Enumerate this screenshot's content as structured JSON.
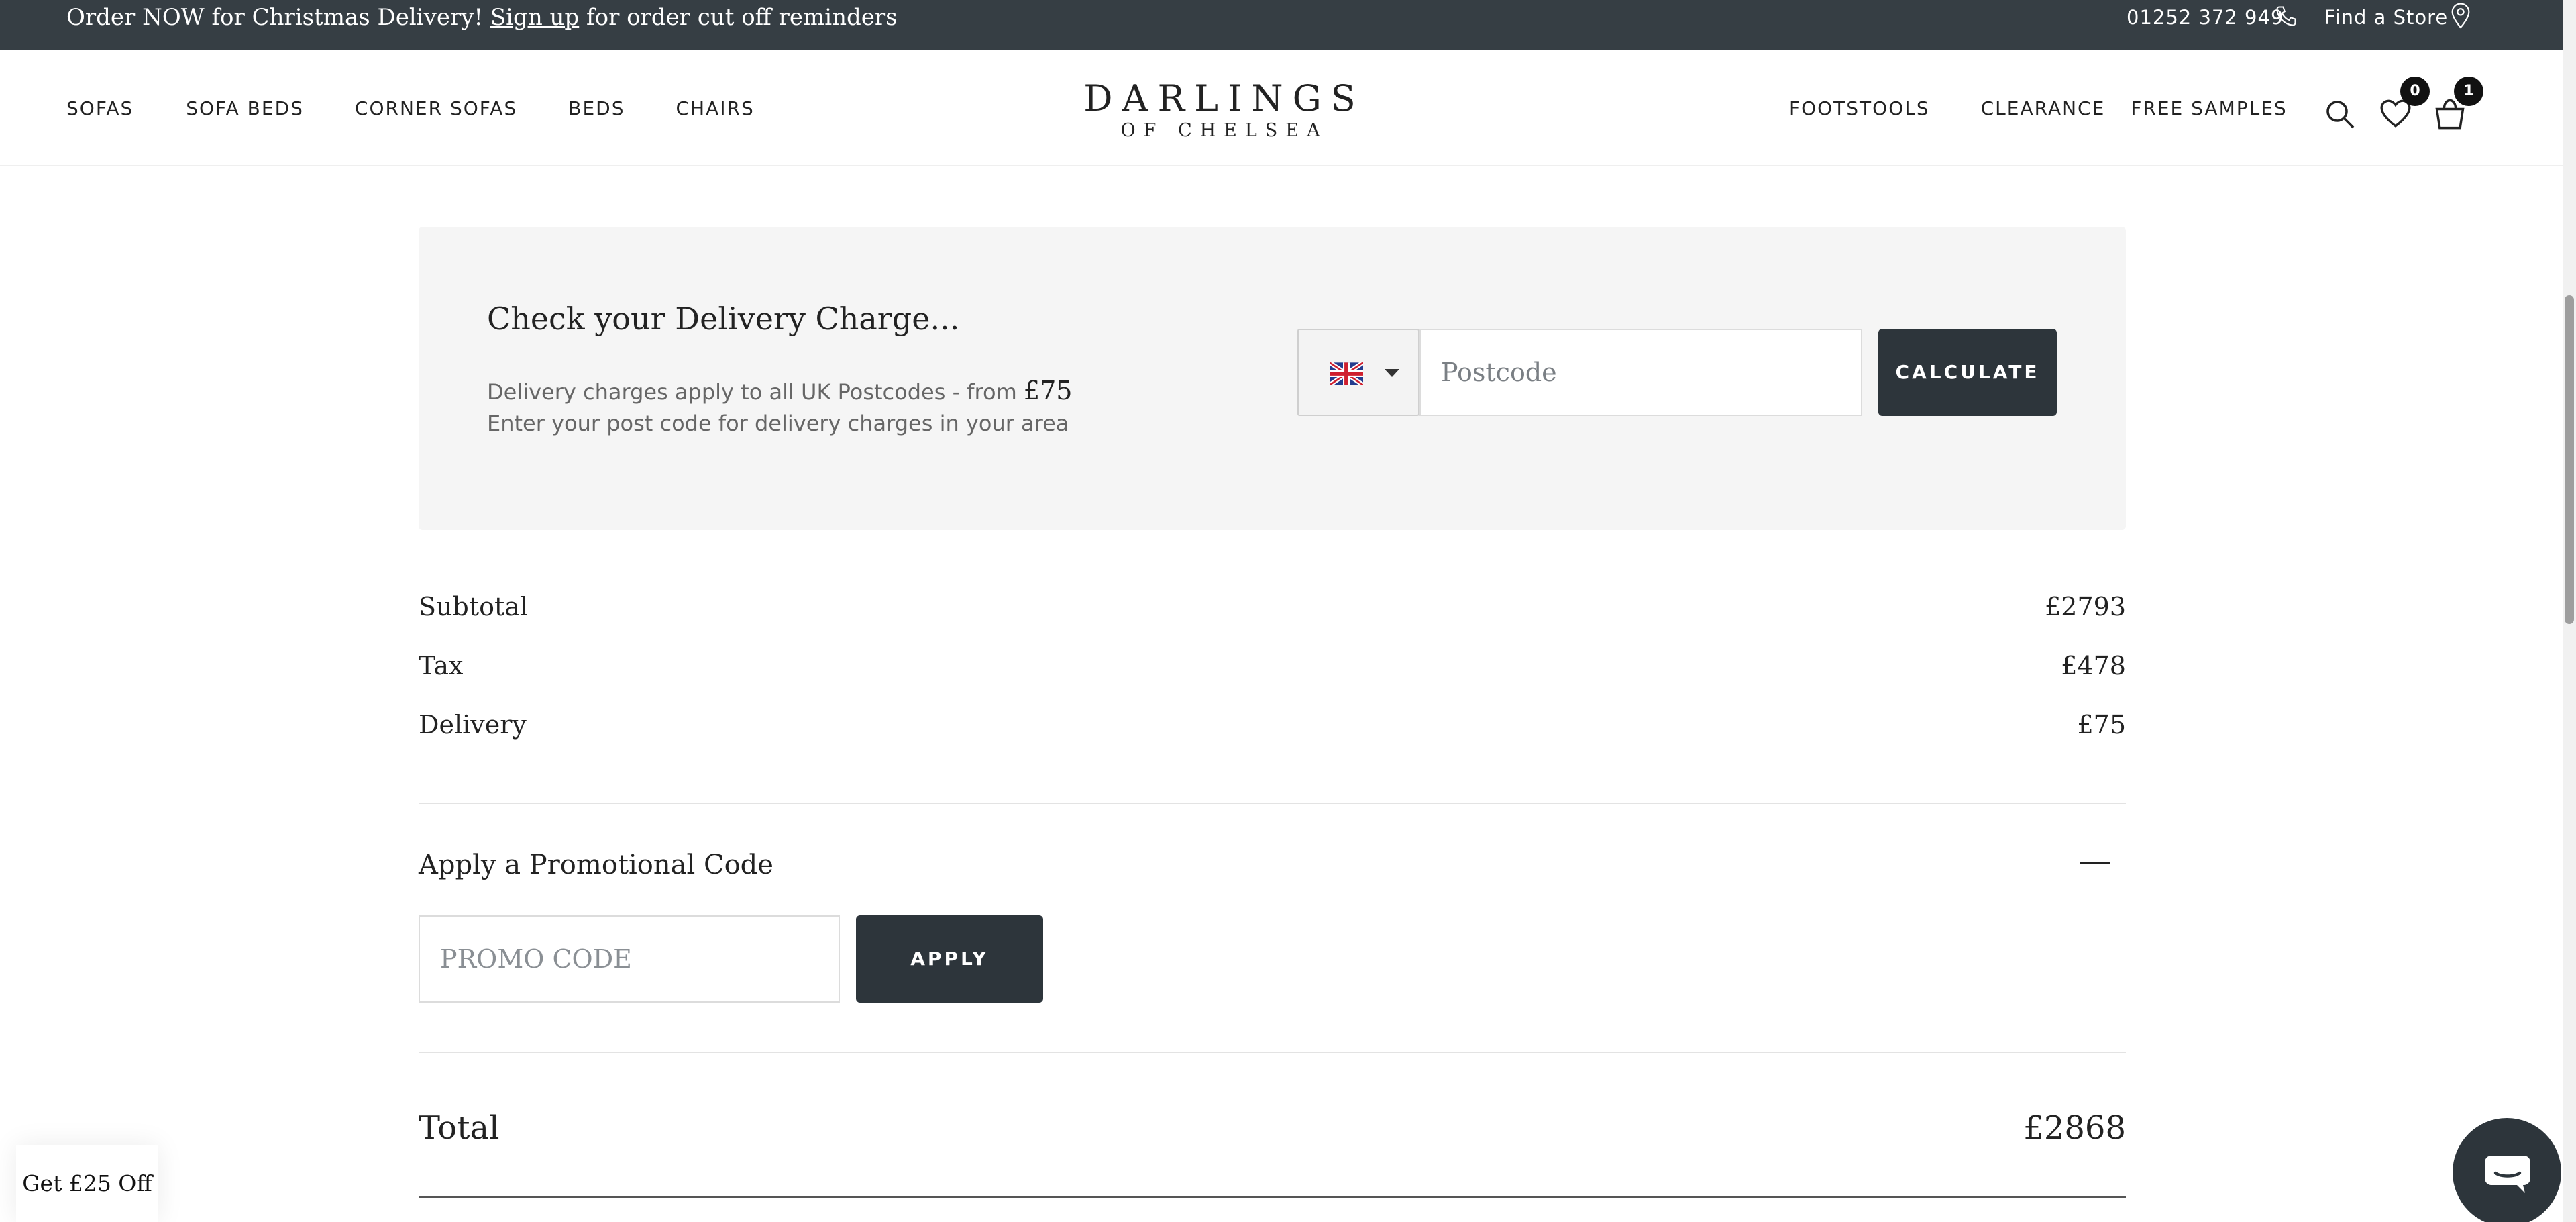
{
  "topbar": {
    "promo_prefix": "Order NOW for Christmas Delivery!",
    "signup_link": "Sign up",
    "promo_suffix": "for order cut off reminders",
    "phone": "01252 372 949",
    "find_store": "Find a Store"
  },
  "header": {
    "nav_left": [
      "SOFAS",
      "SOFA BEDS",
      "CORNER SOFAS",
      "BEDS",
      "CHAIRS"
    ],
    "logo_line1": "DARLINGS",
    "logo_line2": "OF CHELSEA",
    "nav_right": [
      "FOOTSTOOLS",
      "CLEARANCE",
      "FREE SAMPLES"
    ],
    "wishlist_count": "0",
    "basket_count": "1"
  },
  "delivery": {
    "title": "Check your Delivery Charge...",
    "line1_prefix": "Delivery charges apply to all UK Postcodes - from",
    "line1_amount": "£75",
    "line2": "Enter your post code for delivery charges in your area",
    "postcode_placeholder": "Postcode",
    "calculate_label": "CALCULATE"
  },
  "summary": {
    "rows": [
      {
        "label": "Subtotal",
        "value": "£2793"
      },
      {
        "label": "Tax",
        "value": "£478"
      },
      {
        "label": "Delivery",
        "value": "£75"
      }
    ]
  },
  "promo": {
    "title": "Apply a Promotional Code",
    "placeholder": "PROMO CODE",
    "apply_label": "APPLY"
  },
  "total": {
    "label": "Total",
    "value": "£2868"
  },
  "widgets": {
    "discount_tab": "Get £25 Off"
  },
  "colors": {
    "topbar": "#363e44",
    "button": "#2d353b",
    "panel": "#f5f5f5"
  }
}
